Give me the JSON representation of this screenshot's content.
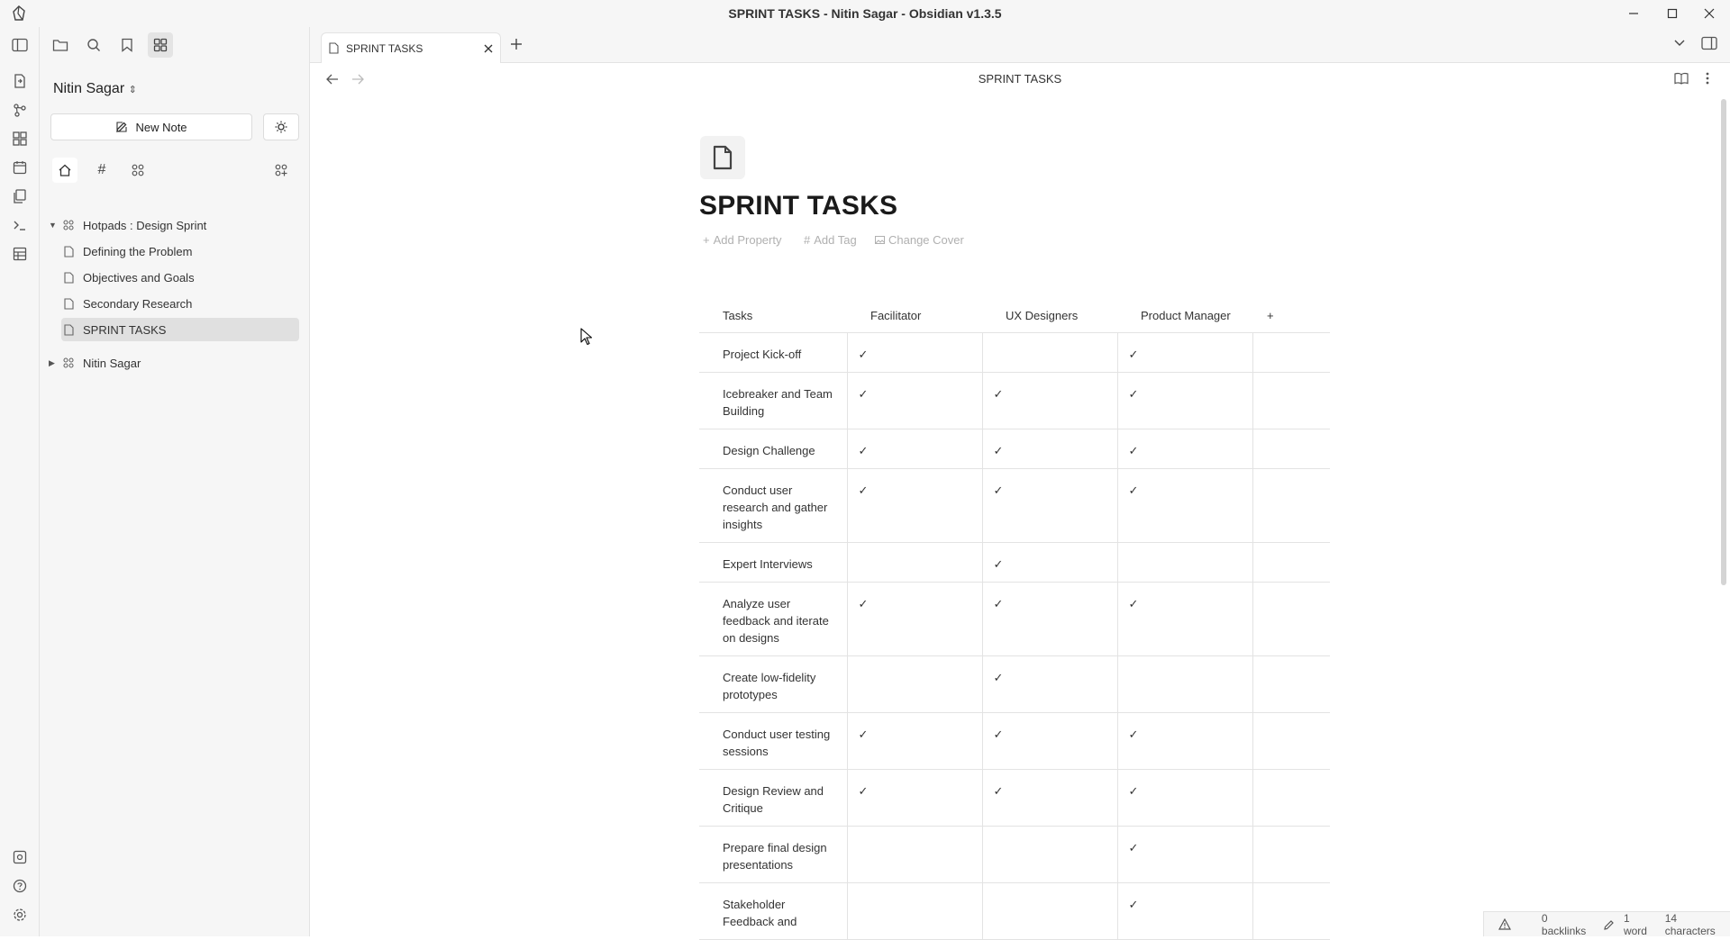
{
  "window": {
    "title": "SPRINT TASKS - Nitin Sagar - Obsidian v1.3.5"
  },
  "ribbon": {
    "icons": [
      "logo-icon",
      "open-quick-switcher-icon",
      "graph-view-icon",
      "canvas-icon",
      "daily-note-icon",
      "templates-icon",
      "command-palette-icon",
      "table-icon",
      "vault-icon",
      "help-icon",
      "settings-icon"
    ]
  },
  "sidebar": {
    "workspace_name": "Nitin Sagar",
    "new_note_label": "New Note",
    "tree": [
      {
        "label": "Hotpads : Design Sprint",
        "type": "folder",
        "expanded": true
      },
      {
        "label": "Defining the Problem",
        "type": "note"
      },
      {
        "label": "Objectives and Goals",
        "type": "note"
      },
      {
        "label": "Secondary Research",
        "type": "note"
      },
      {
        "label": "SPRINT TASKS",
        "type": "note",
        "active": true
      },
      {
        "label": "Nitin Sagar",
        "type": "folder",
        "expanded": false
      }
    ]
  },
  "tabs": [
    {
      "label": "SPRINT TASKS",
      "active": true
    }
  ],
  "view": {
    "header_title": "SPRINT TASKS",
    "page_title": "SPRINT TASKS",
    "actions": {
      "add_property": "Add Property",
      "add_tag": "Add Tag",
      "change_cover": "Change Cover"
    }
  },
  "table": {
    "headers": [
      "Tasks",
      "Facilitator",
      "UX Designers",
      "Product Manager",
      "+"
    ],
    "check_glyph": "✓",
    "rows": [
      {
        "task": "Project Kick-off",
        "checks": [
          true,
          false,
          true
        ]
      },
      {
        "task": "Icebreaker and Team Building",
        "checks": [
          true,
          true,
          true
        ]
      },
      {
        "task": "Design Challenge",
        "checks": [
          true,
          true,
          true
        ]
      },
      {
        "task": "Conduct user research and gather insights",
        "checks": [
          true,
          true,
          true
        ]
      },
      {
        "task": "Expert Interviews",
        "checks": [
          false,
          true,
          false
        ]
      },
      {
        "task": "Analyze user feedback and iterate on designs",
        "checks": [
          true,
          true,
          true
        ]
      },
      {
        "task": "Create low-fidelity prototypes",
        "checks": [
          false,
          true,
          false
        ]
      },
      {
        "task": "Conduct user testing sessions",
        "checks": [
          true,
          true,
          true
        ]
      },
      {
        "task": "Design Review and Critique",
        "checks": [
          true,
          true,
          true
        ]
      },
      {
        "task": "Prepare final design presentations",
        "checks": [
          false,
          false,
          true
        ]
      },
      {
        "task": "Stakeholder Feedback and",
        "checks": [
          false,
          false,
          true
        ]
      }
    ]
  },
  "statusbar": {
    "backlinks": "0 backlinks",
    "words": "1 word",
    "characters": "14 characters"
  },
  "colors": {
    "accent": "#7b6cd9",
    "chrome": "#f6f6f6",
    "border": "#e3e3e3",
    "muted": "#b0b0b0"
  }
}
